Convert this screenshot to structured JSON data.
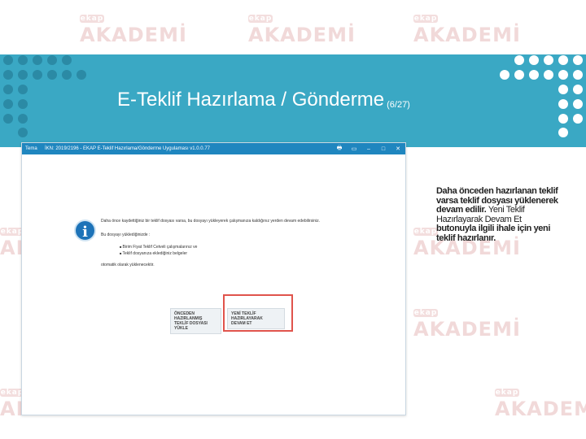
{
  "slide": {
    "title": "E-Teklif Hazırlama /  Gönderme",
    "page_number": "(6/27)"
  },
  "watermark": {
    "brand": "AKADEMİ",
    "badge": "ekap"
  },
  "app_window": {
    "app_name": "Tema",
    "caption": "İKN: 2019/2196 - EKAP E-Teklif Hazırlama/Gönderme Uygulaması v1.0.0.77",
    "controls": [
      "🖶",
      "▭",
      "–",
      "□",
      "✕"
    ],
    "message_line1": "Daha önce kaydettiğiniz bir teklif dosyası varsa, bu dosyayı yükleyerek çalışmanıza kaldığınız yerden devam edebilirsiniz.",
    "message_line2": "Bu dosyayı yüklediğinizde :",
    "bullet1": "Birim Fiyat Teklif Cetveli çalışmalarınız ve",
    "bullet2": "Teklif dosyanıza eklediğiniz belgeler",
    "message_line3": "otomatik olarak yüklenecektir.",
    "button_load_line1": "ÖNCEDEN HAZIRLANMIŞ",
    "button_load_line2": "TEKLİF DOSYASI YÜKLE",
    "button_new_line1": "YENİ TEKLİF HAZIRLAYARAK",
    "button_new_line2": "DEVAM ET"
  },
  "side_note": {
    "bold1": "Daha önceden hazırlanan teklif varsa teklif dosyası yüklenerek devam edilir.",
    "normal": "Yeni Teklif Hazırlayarak Devam Et",
    "bold2": "butonuyla ilgili ihale için yeni teklif hazırlanır."
  },
  "colors": {
    "banner": "#3aa8c4",
    "highlight": "#e0544c",
    "titlebar": "#1f86bf"
  }
}
